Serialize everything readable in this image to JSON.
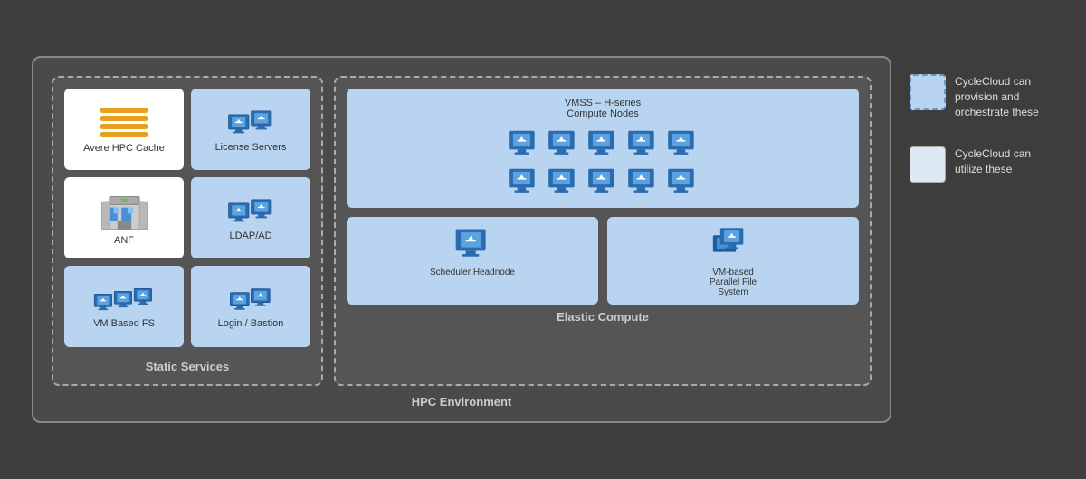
{
  "title": "HPC Environment",
  "main_border_color": "#888",
  "sections": {
    "static_services": {
      "label": "Static Services",
      "cards": [
        {
          "id": "avere-hpc",
          "label": "Avere HPC Cache",
          "bg": "white",
          "icon": "hpc-cache"
        },
        {
          "id": "license-servers",
          "label": "License Servers",
          "bg": "blue",
          "icon": "double-monitor"
        },
        {
          "id": "anf",
          "label": "ANF",
          "bg": "white",
          "icon": "anf"
        },
        {
          "id": "ldap-ad",
          "label": "LDAP/AD",
          "bg": "blue",
          "icon": "double-monitor"
        },
        {
          "id": "vm-based-fs",
          "label": "VM Based FS",
          "bg": "blue",
          "icon": "triple-monitor"
        },
        {
          "id": "login-bastion",
          "label": "Login / Bastion",
          "bg": "blue",
          "icon": "double-monitor-small"
        }
      ]
    },
    "elastic_compute": {
      "label": "Elastic Compute",
      "vmss_label": "VMSS – H-series\nCompute Nodes",
      "scheduler_label": "Scheduler Headnode",
      "parallel_fs_label": "VM-based\nParallel File\nSystem",
      "node_count": 10
    }
  },
  "legend": [
    {
      "id": "provision",
      "text": "CycleCloud can provision and orchestrate these"
    },
    {
      "id": "utilize",
      "text": "CycleCloud can utilize these"
    }
  ]
}
